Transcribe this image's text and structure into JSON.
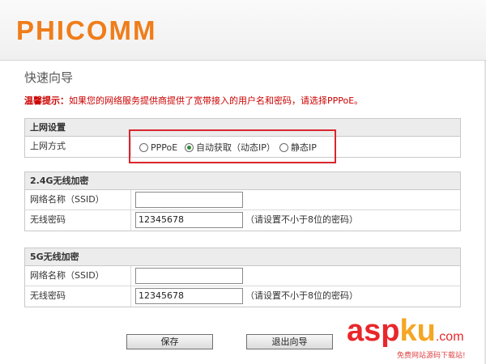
{
  "header": {
    "brand": "PHICOMM"
  },
  "page": {
    "title": "快速向导",
    "tip_label": "温馨提示：",
    "tip_text": "如果您的网络服务提供商提供了宽带接入的用户名和密码，请选择PPPoE。"
  },
  "internet": {
    "section_title": "上网设置",
    "mode_label": "上网方式",
    "options": [
      "PPPoE",
      "自动获取（动态IP）",
      "静态IP"
    ],
    "selected": "自动获取（动态IP）"
  },
  "wifi_24": {
    "section_title": "2.4G无线加密",
    "ssid_label": "网络名称（SSID）",
    "ssid_value": "",
    "password_label": "无线密码",
    "password_value": "12345678",
    "password_hint": "（请设置不小于8位的密码）"
  },
  "wifi_5": {
    "section_title": "5G无线加密",
    "ssid_label": "网络名称（SSID）",
    "ssid_value": "",
    "password_label": "无线密码",
    "password_value": "12345678",
    "password_hint": "（请设置不小于8位的密码）"
  },
  "buttons": {
    "save": "保存",
    "exit": "退出向导"
  },
  "watermark": {
    "asp": "asp",
    "ku": "ku",
    "domain": ".com",
    "subtitle": "免费网站源码下载站!"
  },
  "colors": {
    "brand": "#ef7d1a",
    "tip": "#cc0000",
    "highlight": "#d9262c",
    "radio_checked": "#2e8b3a"
  }
}
